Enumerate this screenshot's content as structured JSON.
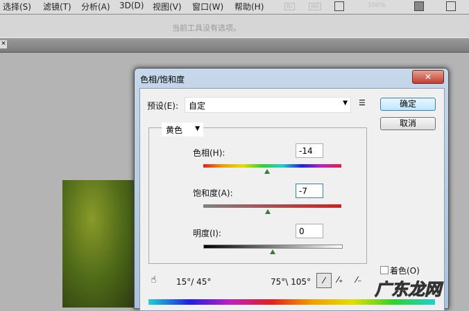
{
  "menu": [
    "选择(S)",
    "滤镜(T)",
    "分析(A)",
    "3D(D)",
    "视图(V)",
    "窗口(W)",
    "帮助(H)"
  ],
  "toolbar": {
    "br": "Br",
    "mb": "Mb",
    "zoom": "100%"
  },
  "options_text": "当前工具没有选项。",
  "dialog": {
    "title": "色相/饱和度",
    "preset_label": "预设(E):",
    "preset_value": "自定",
    "ok": "确定",
    "cancel": "取消",
    "channel": "黄色",
    "hue_label": "色相(H):",
    "hue_value": "-14",
    "sat_label": "饱和度(A):",
    "sat_value": "-7",
    "light_label": "明度(I):",
    "light_value": "0",
    "colorize": "着色(O)",
    "range_left": "15°/ 45°",
    "range_right": "75°\\ 105°",
    "hue_pos": 0.46,
    "sat_pos": 0.465,
    "light_pos": 0.5
  },
  "watermark": "广东龙网"
}
